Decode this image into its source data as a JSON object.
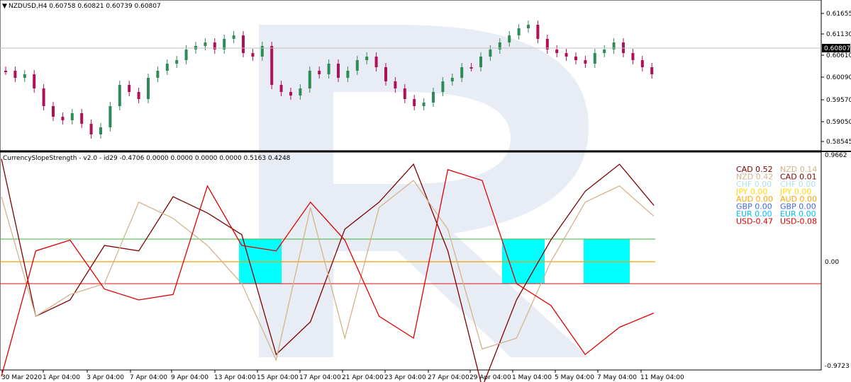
{
  "chart": {
    "symbol_header": "NZDUSD,H4  0.60758 0.60821 0.60739 0.60807",
    "current_price": "0.60807",
    "price_ticks": [
      "0.61655",
      "0.61130",
      "0.60610",
      "0.60090",
      "0.59570",
      "0.59050",
      "0.58545"
    ],
    "up_color": "#2e8b57",
    "down_color": "#b0105a"
  },
  "indicator": {
    "header": "CurrencySlopeStrength - v2.0 - id29 -0.4706 0.0000 0.0000 0.0000 0.0000 0.5163 0.4248",
    "axis_ticks": [
      "0.9662",
      "0.00",
      "-0.9723"
    ],
    "highlight_color": "#00ffff",
    "strength_rows": [
      {
        "left": "CAD 0.52",
        "left_color": "#800000",
        "right": "NZD 0.14",
        "right_color": "#d2b48c"
      },
      {
        "left": "NZD 0.42",
        "left_color": "#d2b48c",
        "right": "CAD 0.01",
        "right_color": "#800000"
      },
      {
        "left": "CHF 0.00",
        "left_color": "#b0e0e6",
        "right": "CHF 0.00",
        "right_color": "#b0e0e6"
      },
      {
        "left": "JPY 0.00",
        "left_color": "#ffd700",
        "right": "JPY 0.00",
        "right_color": "#ffd700"
      },
      {
        "left": "AUD 0.00",
        "left_color": "#ffa500",
        "right": "AUD 0.00",
        "right_color": "#ffa500"
      },
      {
        "left": "GBP 0.00",
        "left_color": "#4169e1",
        "right": "GBP 0.00",
        "right_color": "#4169e1"
      },
      {
        "left": "EUR 0.00",
        "left_color": "#00bfff",
        "right": "EUR 0.00",
        "right_color": "#00bfff"
      },
      {
        "left": "USD-0.47",
        "left_color": "#e00000",
        "right": "USD-0.08",
        "right_color": "#e00000"
      }
    ],
    "series": [
      {
        "name": "CAD",
        "color": "#800000"
      },
      {
        "name": "NZD",
        "color": "#d2b48c"
      },
      {
        "name": "USD",
        "color": "#e00000"
      }
    ]
  },
  "time_axis": [
    "30 Mar 2020",
    "1 Apr 04:00",
    "3 Apr 04:00",
    "7 Apr 04:00",
    "9 Apr 04:00",
    "13 Apr 04:00",
    "15 Apr 04:00",
    "17 Apr 04:00",
    "21 Apr 04:00",
    "23 Apr 04:00",
    "27 Apr 04:00",
    "29 Apr 04:00",
    "1 May 04:00",
    "5 May 04:00",
    "7 May 04:00",
    "11 May 04:00"
  ],
  "chart_data": {
    "type": "line",
    "x": [
      "30 Mar 2020",
      "1 Apr 04:00",
      "3 Apr 04:00",
      "7 Apr 04:00",
      "9 Apr 04:00",
      "13 Apr 04:00",
      "15 Apr 04:00",
      "17 Apr 04:00",
      "21 Apr 04:00",
      "23 Apr 04:00",
      "27 Apr 04:00",
      "29 Apr 04:00",
      "1 May 04:00",
      "5 May 04:00",
      "7 May 04:00",
      "11 May 04:00"
    ],
    "ylim": [
      -0.9723,
      0.9662
    ],
    "series": [
      {
        "name": "CAD",
        "values": [
          0.95,
          -0.5,
          -0.35,
          0.15,
          0.1,
          0.6,
          0.45,
          0.25,
          -0.85,
          -0.55,
          0.3,
          0.55,
          0.9,
          0.1,
          -1.15,
          -0.35,
          0.2,
          0.65,
          0.9,
          0.52
        ]
      },
      {
        "name": "NZD",
        "values": [
          0.6,
          -0.5,
          -0.3,
          -0.2,
          0.55,
          0.4,
          0.15,
          -0.2,
          -0.9,
          0.5,
          -0.7,
          0.5,
          0.75,
          0.3,
          -0.8,
          -0.7,
          0.0,
          0.55,
          0.7,
          0.42
        ]
      },
      {
        "name": "USD",
        "values": [
          -1.05,
          0.1,
          0.2,
          -0.25,
          -0.35,
          -0.3,
          0.7,
          0.15,
          0.1,
          0.55,
          0.2,
          -0.5,
          -0.7,
          0.85,
          0.75,
          -0.2,
          -0.4,
          -0.85,
          -0.6,
          -0.47
        ]
      }
    ]
  }
}
